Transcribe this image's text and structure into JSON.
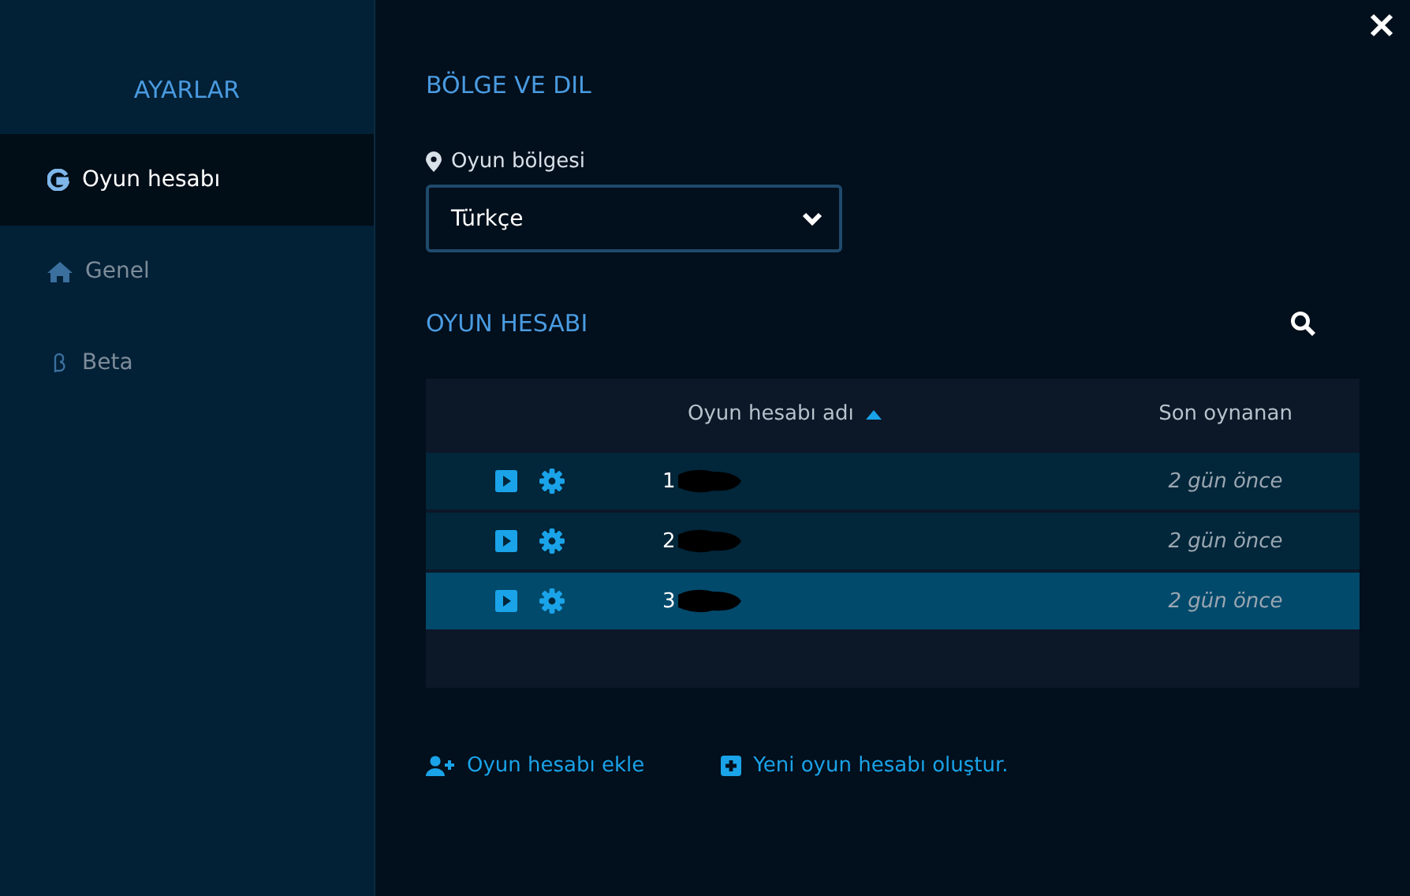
{
  "sidebar": {
    "title": "AYARLAR",
    "items": [
      {
        "label": "Oyun hesabı",
        "kind": "account",
        "selected": true
      },
      {
        "label": "Genel",
        "kind": "home",
        "selected": false
      },
      {
        "label": "Beta",
        "kind": "beta",
        "selected": false
      }
    ]
  },
  "region_section": {
    "title": "BÖLGE VE DIL",
    "field_label": "Oyun bölgesi",
    "select_value": "Türkçe"
  },
  "accounts_section": {
    "title": "OYUN HESABI",
    "table": {
      "columns": [
        {
          "label": "Oyun hesabı adı",
          "sorted": true
        },
        {
          "label": "Son oynanan",
          "sorted": false
        }
      ],
      "rows": [
        {
          "name": "1",
          "last_played": "2 gün önce",
          "selected": false
        },
        {
          "name": "2",
          "last_played": "2 gün önce",
          "selected": false
        },
        {
          "name": "3",
          "last_played": "2 gün önce",
          "selected": true
        }
      ]
    }
  },
  "actions": [
    {
      "label": "Oyun hesabı ekle",
      "kind": "add-user"
    },
    {
      "label": "Yeni oyun hesabı oluştur.",
      "kind": "plus"
    }
  ]
}
